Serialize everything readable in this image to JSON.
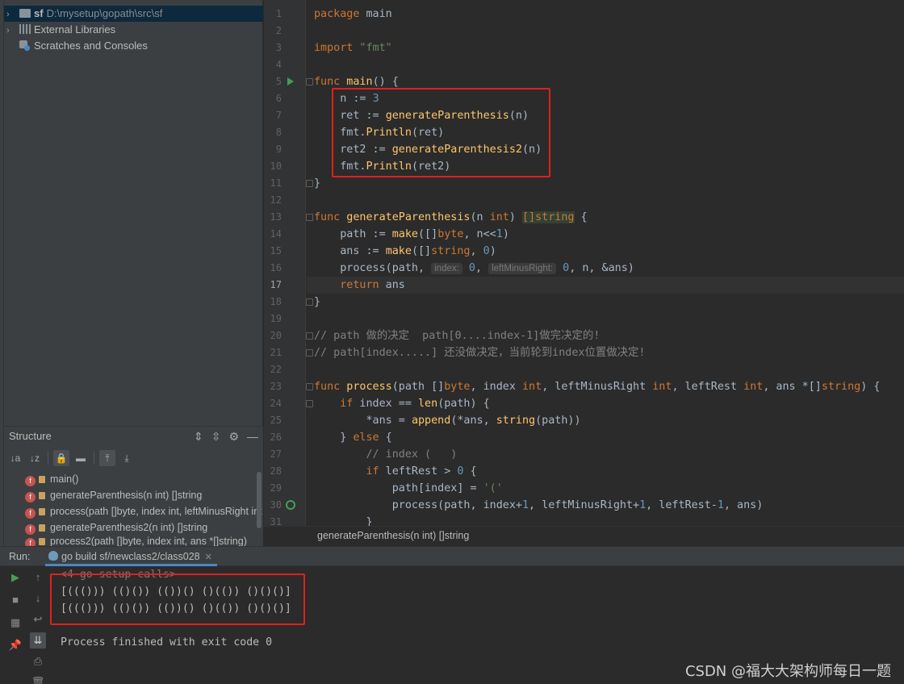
{
  "project_tree": {
    "items": [
      {
        "arrow": "›",
        "icon": "folder-icon",
        "name": "sf",
        "path": "D:\\mysetup\\gopath\\src\\sf"
      },
      {
        "arrow": "›",
        "icon": "libraries-icon",
        "name": "External Libraries"
      },
      {
        "arrow": "",
        "icon": "scratches-icon",
        "name": "Scratches and Consoles"
      }
    ]
  },
  "structure": {
    "title": "Structure",
    "items": [
      {
        "label": "main()"
      },
      {
        "label": "generateParenthesis(n int) []string"
      },
      {
        "label": "process(path []byte, index int, leftMinusRight int, leftRest int, ans *[]string)"
      },
      {
        "label": "generateParenthesis2(n int) []string"
      },
      {
        "label": "process2(path []byte, index int, ans *[]string)"
      }
    ]
  },
  "editor": {
    "line_numbers": [
      "1",
      "2",
      "3",
      "4",
      "5",
      "6",
      "7",
      "8",
      "9",
      "10",
      "11",
      "12",
      "13",
      "14",
      "15",
      "16",
      "17",
      "18",
      "19",
      "20",
      "21",
      "22",
      "23",
      "24",
      "25",
      "26",
      "27",
      "28",
      "29",
      "30",
      "31"
    ],
    "current_line": "17",
    "code": {
      "l1_kw": "package",
      "l1_rest": " main",
      "l3_kw": "import",
      "l3_str": " \"fmt\"",
      "l5_kw": "func",
      "l5_fn": " main",
      "l5_rest": "() {",
      "l6_a": "    n := ",
      "l6_num": "3",
      "l7_a": "    ret := ",
      "l7_fn": "generateParenthesis",
      "l7_b": "(n)",
      "l8_a": "    fmt.",
      "l8_fn": "Println",
      "l8_b": "(ret)",
      "l9_a": "    ret2 := ",
      "l9_fn": "generateParenthesis2",
      "l9_b": "(n)",
      "l10_a": "    fmt.",
      "l10_fn": "Println",
      "l10_b": "(ret2)",
      "l11": "}",
      "l13_kw": "func",
      "l13_fn": " generateParenthesis",
      "l13_a": "(n ",
      "l13_kw2": "int",
      "l13_b": ") ",
      "l13_type": "[]string",
      "l13_c": " {",
      "l14_a": "    path := ",
      "l14_fn": "make",
      "l14_b": "([]",
      "l14_kw": "byte",
      "l14_c": ", n<<",
      "l14_num": "1",
      "l14_d": ")",
      "l15_a": "    ans := ",
      "l15_fn": "make",
      "l15_b": "([]",
      "l15_kw": "string",
      "l15_c": ", ",
      "l15_num": "0",
      "l15_d": ")",
      "l16_a": "    process(path, ",
      "l16_h1": "index:",
      "l16_h1v": " 0",
      "l16_b": ", ",
      "l16_h2": "leftMinusRight:",
      "l16_h2v": " 0",
      "l16_c": ", n, &ans)",
      "l17_kw": "    return",
      "l17_b": " ans",
      "l18": "}",
      "l20": "// path 做的决定  path[0....index-1]做完决定的!",
      "l21": "// path[index.....] 还没做决定，当前轮到index位置做决定!",
      "l23_kw": "func",
      "l23_fn": " process",
      "l23_a": "(path []",
      "l23_kw2": "byte",
      "l23_b": ", index ",
      "l23_kw3": "int",
      "l23_c": ", leftMinusRight ",
      "l23_kw4": "int",
      "l23_d": ", leftRest ",
      "l23_kw5": "int",
      "l23_e": ", ans *[]",
      "l23_kw6": "string",
      "l23_f": ") {",
      "l24_kw": "    if",
      "l24_a": " index == ",
      "l24_fn": "len",
      "l24_b": "(path) {",
      "l25_a": "        *ans = ",
      "l25_fn": "append",
      "l25_b": "(*ans, ",
      "l25_fn2": "string",
      "l25_c": "(path))",
      "l26_a": "    } ",
      "l26_kw": "else",
      "l26_b": " {",
      "l27": "        // index (   )",
      "l28_kw": "        if",
      "l28_a": " leftRest > ",
      "l28_num": "0",
      "l28_b": " {",
      "l29_a": "            path[index] = ",
      "l29_str": "'('",
      "l30_a": "            process(path, index+",
      "l30_n1": "1",
      "l30_b": ", leftMinusRight+",
      "l30_n2": "1",
      "l30_c": ", leftRest-",
      "l30_n3": "1",
      "l30_d": ", ans)",
      "l31": "        }"
    }
  },
  "breadcrumb": "generateParenthesis(n int) []string",
  "run": {
    "label": "Run:",
    "tab": "go build sf/newclass2/class028",
    "console": [
      "<4 go setup calls>",
      "[((())) (()()) (())() ()(()) ()()()]",
      "[((())) (()()) (())() ()(()) ()()()]",
      "",
      "Process finished with exit code 0"
    ]
  },
  "watermark": "CSDN @福大大架构师每日一题",
  "colors": {
    "highlight_box": "#e02020",
    "keyword": "#cc7832",
    "function": "#ffc66d",
    "number": "#6897bb"
  }
}
